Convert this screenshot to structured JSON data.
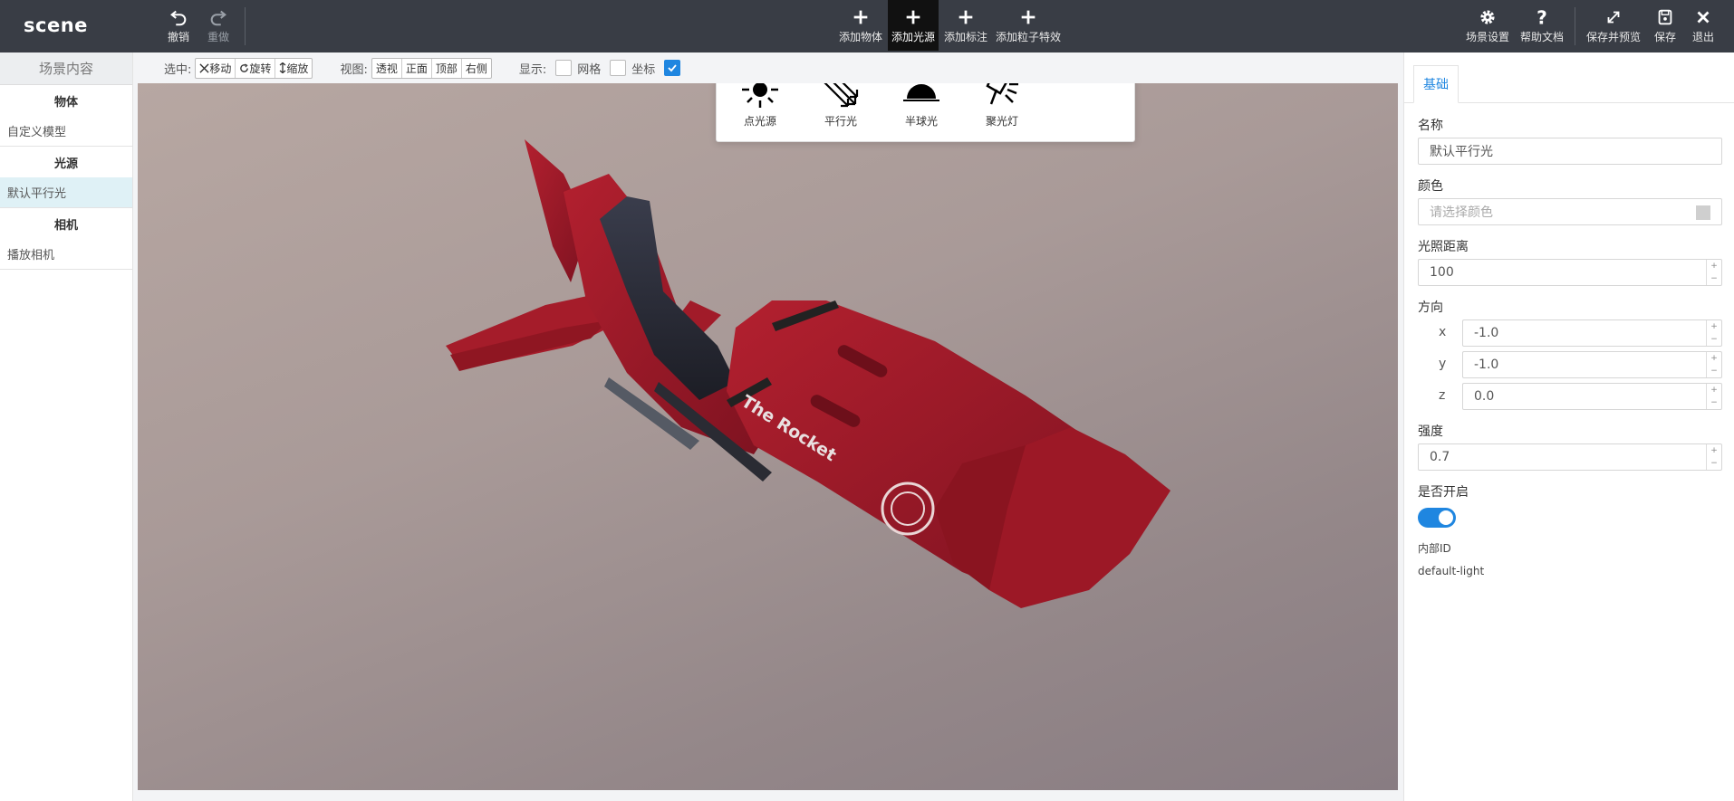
{
  "app": {
    "title": "scene"
  },
  "toolbar": {
    "undo": "撤销",
    "redo": "重做",
    "add_object": "添加物体",
    "add_light": "添加光源",
    "add_annotation": "添加标注",
    "add_particle": "添加粒子特效",
    "scene_settings": "场景设置",
    "help": "帮助文档",
    "save_preview": "保存并预览",
    "save": "保存",
    "exit": "退出"
  },
  "sidebar": {
    "title": "场景内容",
    "groups": [
      {
        "header": "物体",
        "items": [
          "自定义模型"
        ]
      },
      {
        "header": "光源",
        "items": [
          "默认平行光"
        ]
      },
      {
        "header": "相机",
        "items": [
          "播放相机"
        ]
      }
    ]
  },
  "toolstrip": {
    "select_label": "选中:",
    "move": "移动",
    "rotate": "旋转",
    "scale": "缩放",
    "view_label": "视图:",
    "views": [
      "透视",
      "正面",
      "顶部",
      "右侧"
    ],
    "display_label": "显示:",
    "grid": "网格",
    "axes": "坐标"
  },
  "light_menu": {
    "items": [
      "点光源",
      "平行光",
      "半球光",
      "聚光灯"
    ]
  },
  "props": {
    "tab": "基础",
    "name_label": "名称",
    "name_value": "默认平行光",
    "color_label": "颜色",
    "color_placeholder": "请选择颜色",
    "distance_label": "光照距离",
    "distance_value": "100",
    "direction_label": "方向",
    "x_label": "x",
    "x_value": "-1.0",
    "y_label": "y",
    "y_value": "-1.0",
    "z_label": "z",
    "z_value": "0.0",
    "intensity_label": "强度",
    "intensity_value": "0.7",
    "enabled_label": "是否开启",
    "enabled": true,
    "internal_id_label": "内部ID",
    "internal_id_value": "default-light"
  },
  "model": {
    "decal_text": "The Rocket"
  },
  "colors": {
    "topbar": "#393d45",
    "accent": "#1f86e0",
    "model_red": "#a51c2a"
  }
}
